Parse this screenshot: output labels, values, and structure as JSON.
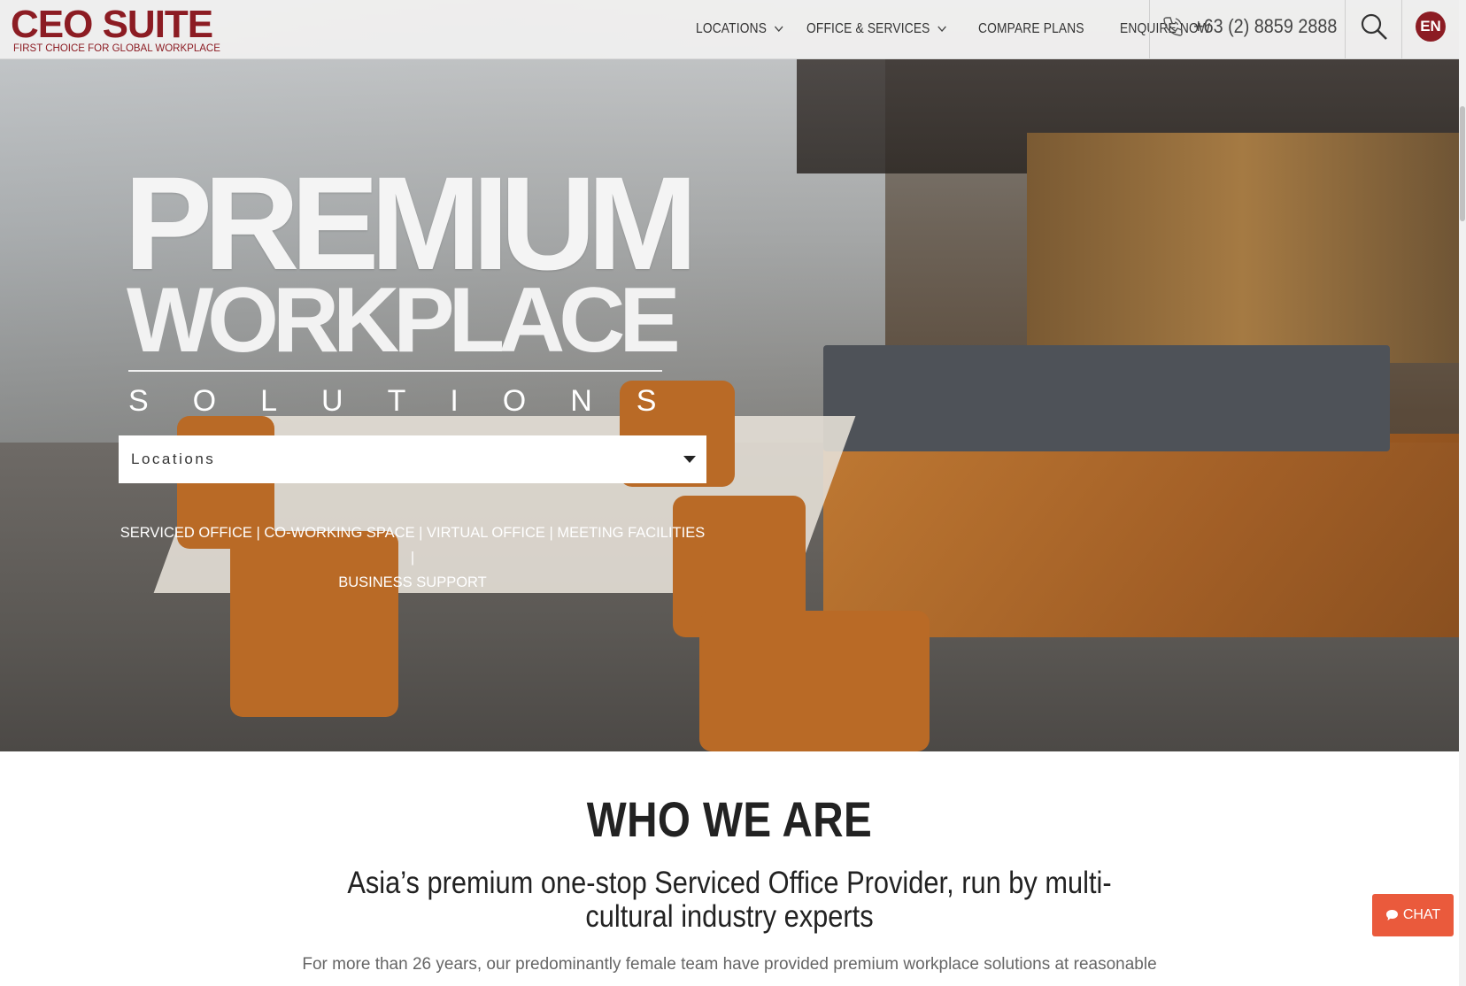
{
  "brand": {
    "name": "CEO SUITE",
    "tagline": "FIRST CHOICE FOR GLOBAL WORKPLACE",
    "color": "#8c1c23"
  },
  "nav": {
    "items": [
      {
        "label": "LOCATIONS",
        "has_dropdown": true
      },
      {
        "label": "OFFICE & SERVICES",
        "has_dropdown": true
      },
      {
        "label": "COMPARE PLANS",
        "has_dropdown": false
      },
      {
        "label": "ENQUIRE NOW",
        "has_dropdown": false
      }
    ],
    "phone": "+63 (2) 8859 2888",
    "phone_icon": "phone-icon",
    "search_icon": "search-icon",
    "language": "EN"
  },
  "hero": {
    "title_line_1": "PREMIUM",
    "title_line_2": "WORKPLACE",
    "title_line_3": "SOLUTIONS",
    "location_select": {
      "placeholder": "Locations"
    },
    "services_line_1": "SERVICED OFFICE | CO-WORKING SPACE | VIRTUAL OFFICE | MEETING FACILITIES |",
    "services_line_2": "BUSINESS SUPPORT"
  },
  "who_we_are": {
    "title": "WHO WE ARE",
    "subtitle": "Asia’s premium one-stop Serviced Office Provider, run by multi-cultural industry experts",
    "body": "For more than 26 years, our predominantly female team have provided premium workplace solutions at reasonable"
  },
  "chat": {
    "label": "CHAT",
    "color": "#ea5a3c"
  }
}
